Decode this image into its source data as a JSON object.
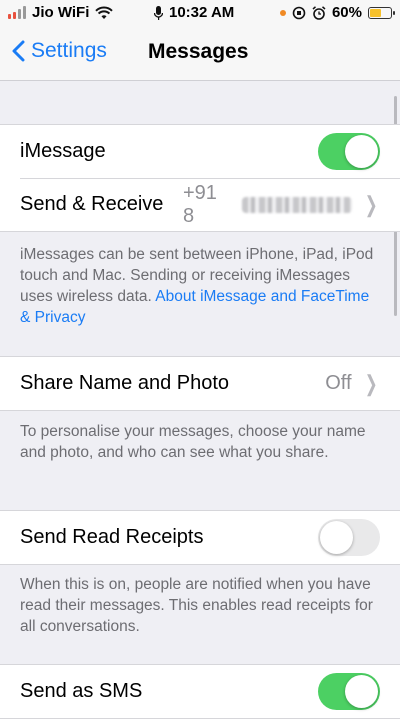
{
  "status_bar": {
    "carrier": "Jio WiFi",
    "time": "10:32 AM",
    "battery": "60%",
    "battery_level": 0.6
  },
  "nav": {
    "back_label": "Settings",
    "title": "Messages"
  },
  "imessage": {
    "label": "iMessage",
    "enabled": true
  },
  "send_receive": {
    "label": "Send & Receive",
    "value_prefix": "+91 8"
  },
  "imessage_footer": {
    "text": "iMessages can be sent between iPhone, iPad, iPod touch and Mac. Sending or receiving iMessages uses wireless data.",
    "link": "About iMessage and FaceTime & Privacy"
  },
  "share_name": {
    "label": "Share Name and Photo",
    "value": "Off"
  },
  "share_footer": {
    "text": "To personalise your messages, choose your name and photo, and who can see what you share."
  },
  "read_receipts": {
    "label": "Send Read Receipts",
    "enabled": false
  },
  "read_receipts_footer": {
    "text": "When this is on, people are notified when you have read their messages. This enables read receipts for all conversations."
  },
  "send_sms": {
    "label": "Send as SMS",
    "enabled": true
  },
  "colors": {
    "accent": "#1a7cf5",
    "toggle_on": "#4cd063",
    "background": "#efeff4"
  }
}
